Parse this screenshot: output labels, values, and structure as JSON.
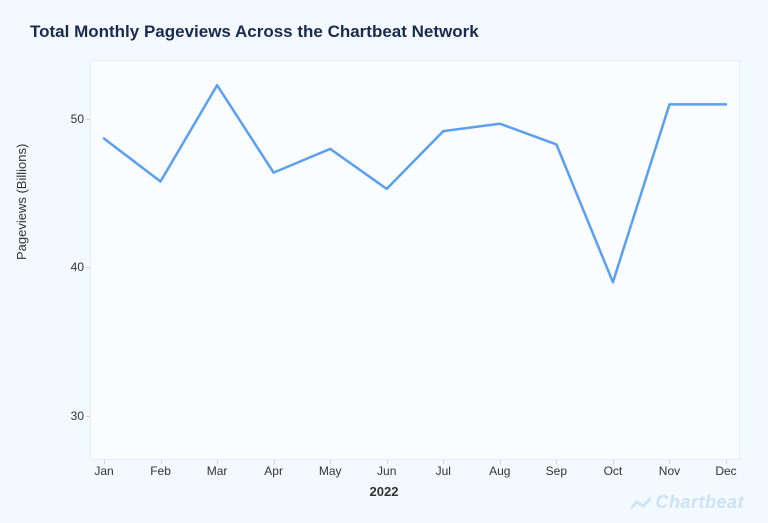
{
  "title": "Total Monthly Pageviews Across the Chartbeat Network",
  "ylabel": "Pageviews (Billions)",
  "xlabel": "2022",
  "brand": "Chartbeat",
  "colors": {
    "line": "#5a9ff0"
  },
  "chart_data": {
    "type": "line",
    "categories": [
      "Jan",
      "Feb",
      "Mar",
      "Apr",
      "May",
      "Jun",
      "Jul",
      "Aug",
      "Sep",
      "Oct",
      "Nov",
      "Dec"
    ],
    "values": [
      48.7,
      45.8,
      52.3,
      46.4,
      48.0,
      45.3,
      49.2,
      49.7,
      48.3,
      39.0,
      51.0,
      51.0
    ],
    "y_ticks": [
      30,
      40,
      50
    ],
    "ylim": [
      27,
      54
    ],
    "title": "Total Monthly Pageviews Across the Chartbeat Network",
    "xlabel": "2022",
    "ylabel": "Pageviews (Billions)"
  }
}
